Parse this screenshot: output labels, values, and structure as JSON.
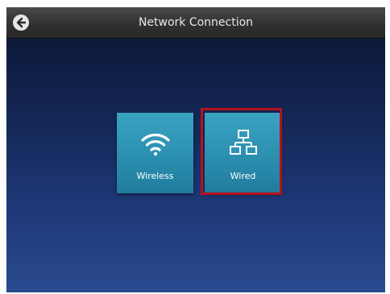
{
  "header": {
    "title": "Network Connection",
    "back_icon": "back-arrow-icon"
  },
  "options": [
    {
      "label": "Wireless",
      "icon": "wifi-icon",
      "selected": false
    },
    {
      "label": "Wired",
      "icon": "wired-network-icon",
      "selected": true
    }
  ],
  "colors": {
    "tile": "#2b8fb0",
    "selection": "#b5121b",
    "background_top": "#0a1430",
    "background_bottom": "#2a4a8f"
  }
}
